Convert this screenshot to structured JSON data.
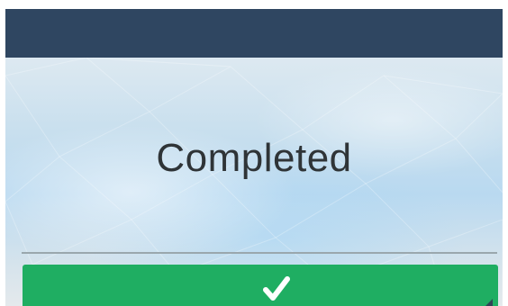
{
  "status": {
    "label": "Completed"
  },
  "action_button": {
    "icon": "check-icon",
    "corner_indicator": "corner-triangle-icon"
  },
  "colors": {
    "top_bar": "#2f4661",
    "button": "#1fae62",
    "text": "#2f3437"
  }
}
